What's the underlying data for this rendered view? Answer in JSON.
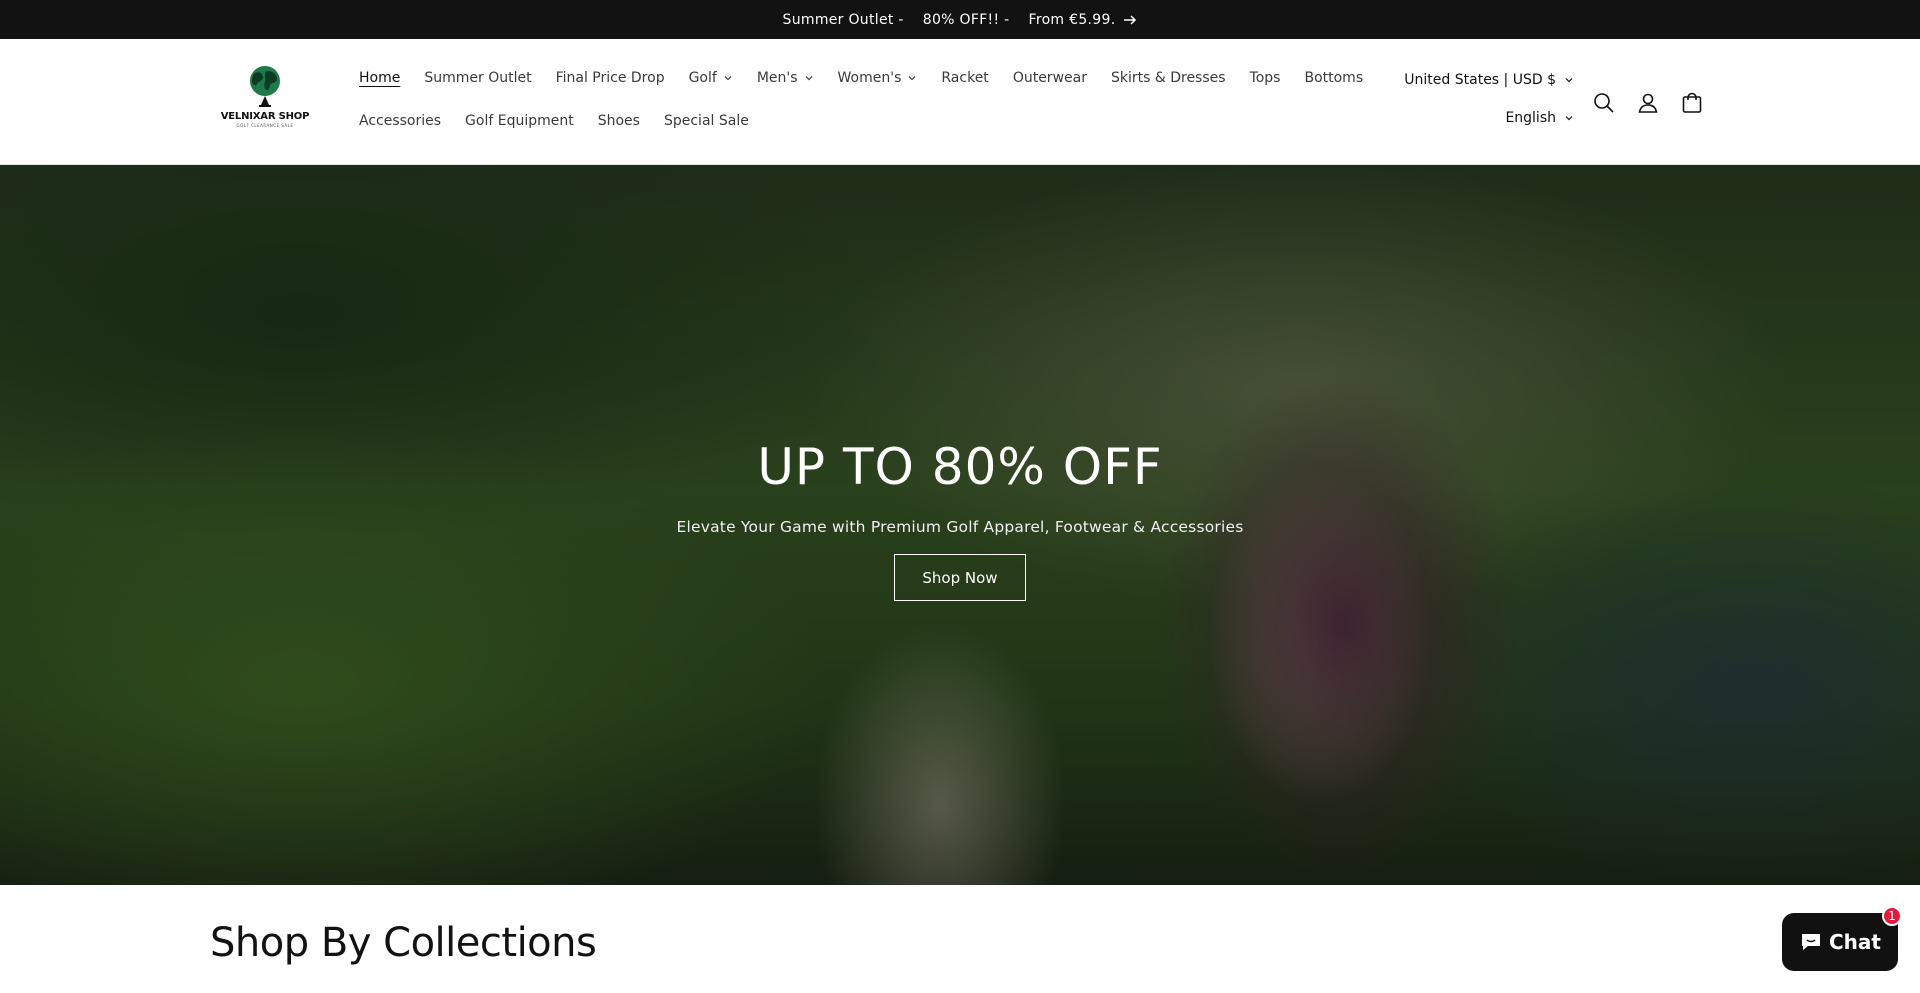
{
  "announcement": {
    "text": "Summer Outlet -    80% OFF!! -    From €5.99."
  },
  "header": {
    "logo": {
      "name": "VELNIXAR SHOP",
      "tagline": "GOLF CLEARANCE SALE"
    },
    "nav_row1": [
      {
        "label": "Home",
        "active": true,
        "dropdown": false
      },
      {
        "label": "Summer Outlet",
        "dropdown": false
      },
      {
        "label": "Final Price Drop",
        "dropdown": false
      },
      {
        "label": "Golf",
        "dropdown": true
      },
      {
        "label": "Men's",
        "dropdown": true
      },
      {
        "label": "Women's",
        "dropdown": true
      },
      {
        "label": "Racket",
        "dropdown": false
      },
      {
        "label": "Outerwear",
        "dropdown": false
      },
      {
        "label": "Skirts & Dresses",
        "dropdown": false
      },
      {
        "label": "Tops",
        "dropdown": false
      },
      {
        "label": "Bottoms",
        "dropdown": false
      }
    ],
    "nav_row2": [
      {
        "label": "Accessories"
      },
      {
        "label": "Golf Equipment"
      },
      {
        "label": "Shoes"
      },
      {
        "label": "Special Sale"
      }
    ],
    "country": "United States | USD $",
    "language": "English",
    "icons": [
      "search-icon",
      "account-icon",
      "cart-icon"
    ]
  },
  "hero": {
    "title": "UP TO 80% OFF",
    "subtitle": "Elevate Your Game with Premium Golf Apparel, Footwear & Accessories",
    "button": "Shop Now"
  },
  "collections": {
    "title": "Shop By Collections"
  },
  "chat": {
    "label": "Chat",
    "badge": "1"
  },
  "colors": {
    "announcement_bg": "#121212",
    "chat_bg": "#111111",
    "badge": "#e21b3c"
  }
}
